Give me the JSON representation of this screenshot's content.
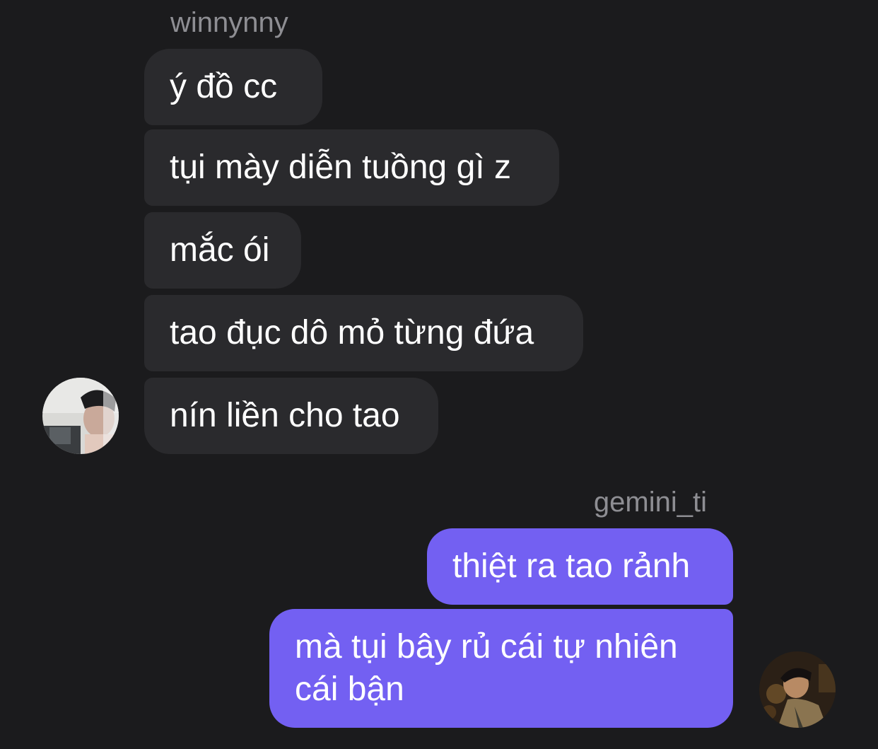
{
  "chat": {
    "incoming_group": {
      "sender": "winnynny",
      "avatar_icon": "profile-photo-icon",
      "messages": [
        "ý đồ cc",
        "tụi mày diễn tuồng gì z",
        "mắc ói",
        "tao đục dô mỏ từng đứa",
        "nín liền cho tao"
      ]
    },
    "outgoing_group": {
      "sender": "gemini_ti",
      "avatar_icon": "profile-photo-icon",
      "messages": [
        "thiệt ra tao rảnh",
        "mà tụi bây rủ cái tự nhiên cái bận"
      ]
    }
  },
  "colors": {
    "background": "#1b1b1d",
    "incoming_bubble": "#2a2a2d",
    "outgoing_bubble": "#7360f2",
    "sender_name": "#8e8e93",
    "message_text": "#ffffff"
  }
}
